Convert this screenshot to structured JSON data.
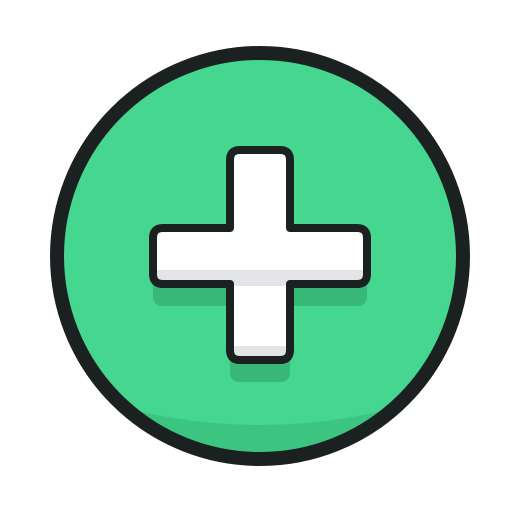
{
  "icon": {
    "name": "add-plus-circle",
    "colors": {
      "circle_fill": "#45D68F",
      "circle_shadow": "#3CC581",
      "outline": "#1B2021",
      "cross_fill": "#FFFFFF",
      "cross_shade": "#E4E4E6",
      "cross_drop_shadow": "#37B877"
    }
  }
}
